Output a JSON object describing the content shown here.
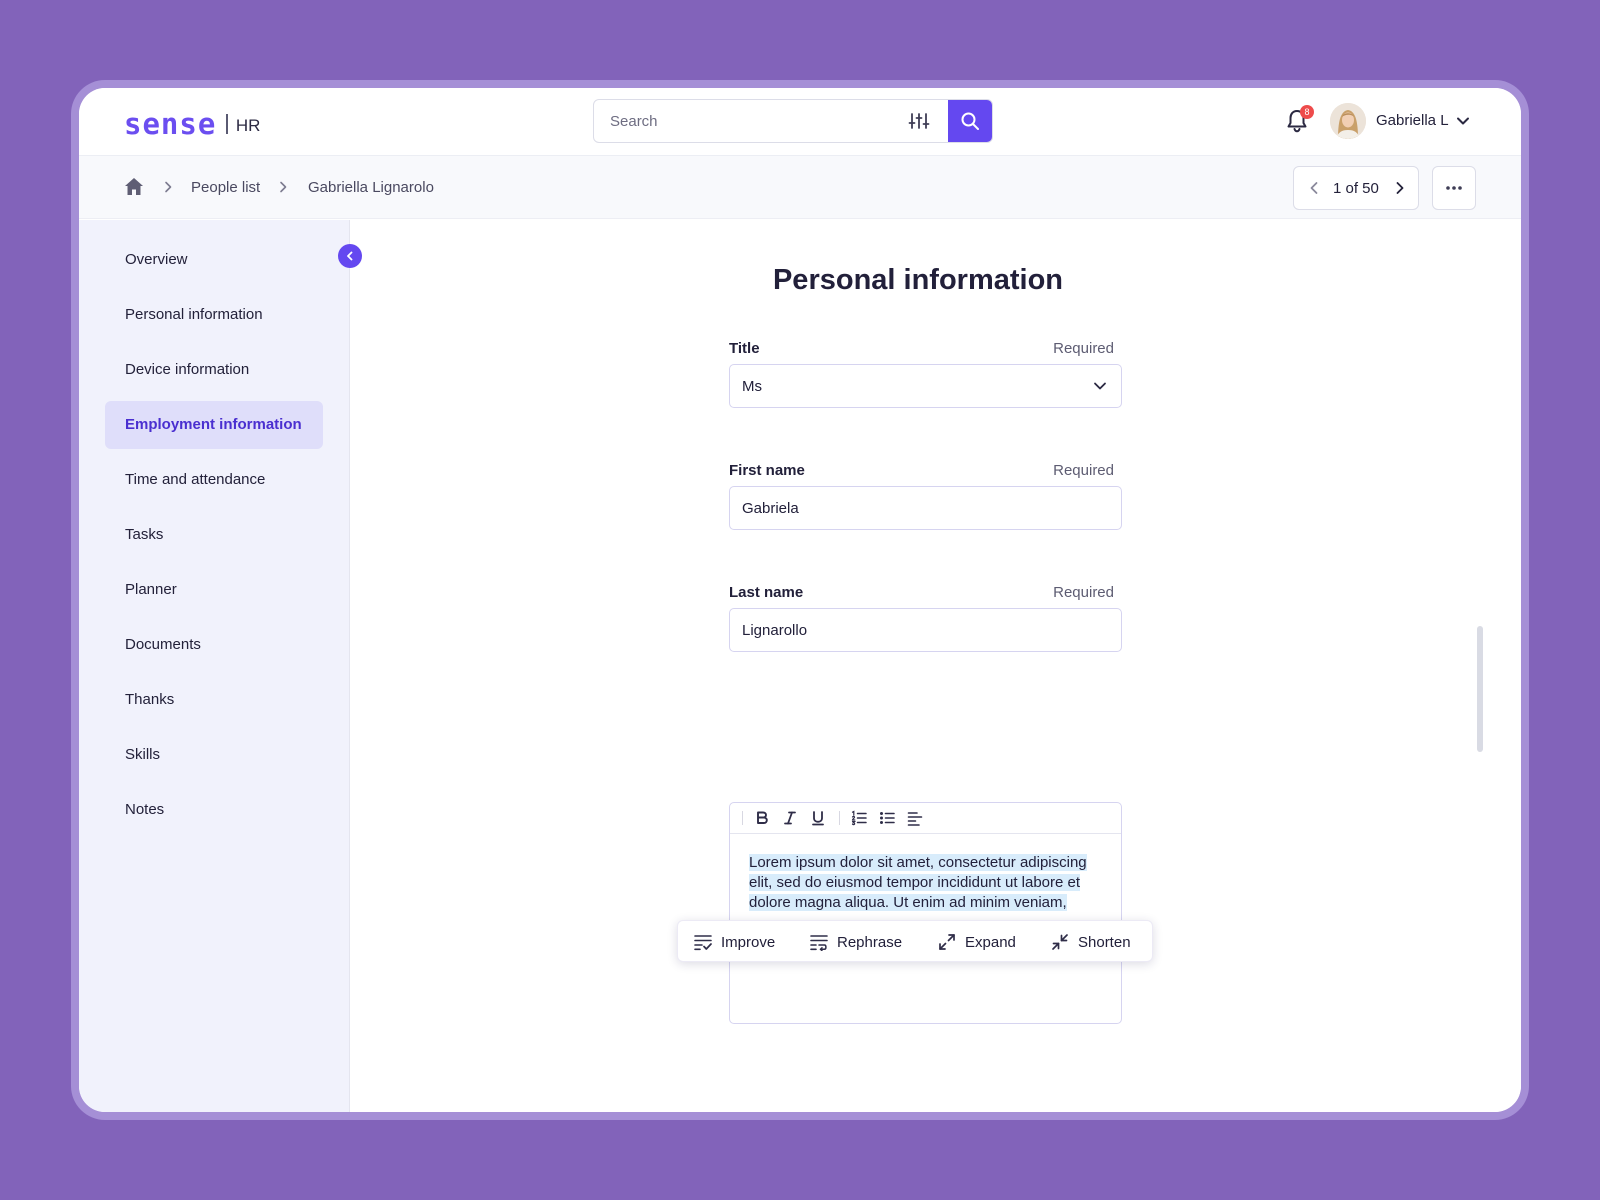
{
  "app": {
    "logo_word": "sense",
    "logo_suffix": "HR"
  },
  "header": {
    "search_placeholder": "Search",
    "notification_count": "8",
    "user_name": "Gabriella L",
    "accent_color": "#6448f0",
    "badge_color": "#ee4b4b"
  },
  "breadcrumb": {
    "home_icon": "home-icon",
    "items": [
      "People list",
      "Gabriella Lignarolo"
    ]
  },
  "pager": {
    "text": "1 of 50"
  },
  "sidebar": {
    "items": [
      {
        "label": "Overview",
        "active": false
      },
      {
        "label": "Personal information",
        "active": false
      },
      {
        "label": "Device information",
        "active": false
      },
      {
        "label": "Employment information",
        "active": true
      },
      {
        "label": "Time and attendance",
        "active": false
      },
      {
        "label": "Tasks",
        "active": false
      },
      {
        "label": "Planner",
        "active": false
      },
      {
        "label": "Documents",
        "active": false
      },
      {
        "label": "Thanks",
        "active": false
      },
      {
        "label": "Skills",
        "active": false
      },
      {
        "label": "Notes",
        "active": false
      }
    ]
  },
  "form": {
    "title": "Personal information",
    "fields": {
      "title": {
        "label": "Title",
        "required": "Required",
        "value": "Ms"
      },
      "first_name": {
        "label": "First name",
        "required": "Required",
        "value": "Gabriela"
      },
      "last_name": {
        "label": "Last name",
        "required": "Required",
        "value": "Lignarollo"
      }
    },
    "editor": {
      "toolbar": [
        "bold-icon",
        "italic-icon",
        "underline-icon",
        "ordered-list-icon",
        "bullet-list-icon",
        "align-left-icon"
      ],
      "text": "Lorem ipsum dolor sit amet, consectetur adipiscing elit, sed do eiusmod tempor incididunt ut labore et dolore magna aliqua. Ut enim ad minim veniam,"
    },
    "ai_actions": {
      "improve": "Improve",
      "rephrase": "Rephrase",
      "expand": "Expand",
      "shorten": "Shorten"
    }
  }
}
